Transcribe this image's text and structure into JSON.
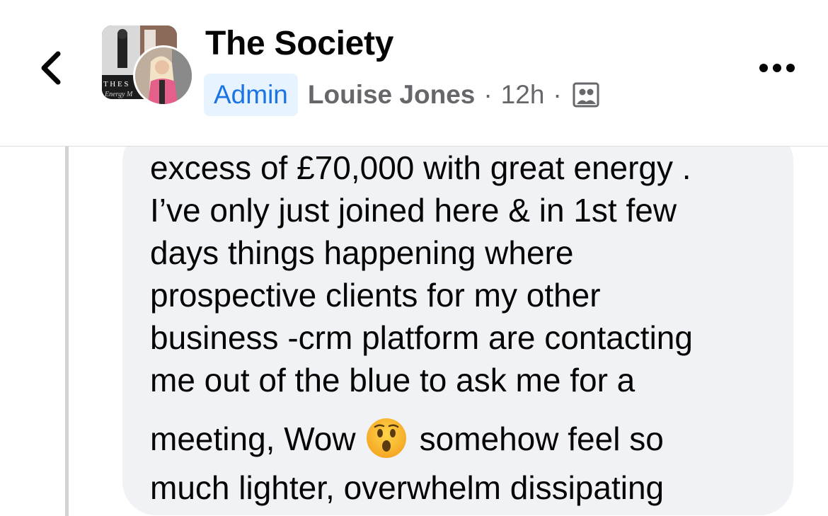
{
  "header": {
    "group_name": "The Society",
    "badge": "Admin",
    "author": "Louise Jones",
    "separator": "·",
    "time": "12h",
    "icons": {
      "back": "chevron-left-icon",
      "audience": "group-members-icon",
      "more": "more-horizontal-icon"
    }
  },
  "comment": {
    "lines": [
      "excess of £70,000 with great energy .",
      "I’ve only just joined here & in 1st few",
      "days things happening where",
      "prospective clients for my other",
      "business -crm platform are contacting",
      "me out of the blue to ask me for a"
    ],
    "emoji_line_before": "meeting, Wow",
    "emoji_line_after": "somehow feel so",
    "emoji": "hushed-face-emoji",
    "last_line": "much lighter, overwhelm dissipating"
  },
  "colors": {
    "admin_badge_bg": "#e7f3ff",
    "admin_badge_text": "#1b74e4",
    "meta_text": "#65676b",
    "bubble_bg": "#f0f2f5"
  }
}
